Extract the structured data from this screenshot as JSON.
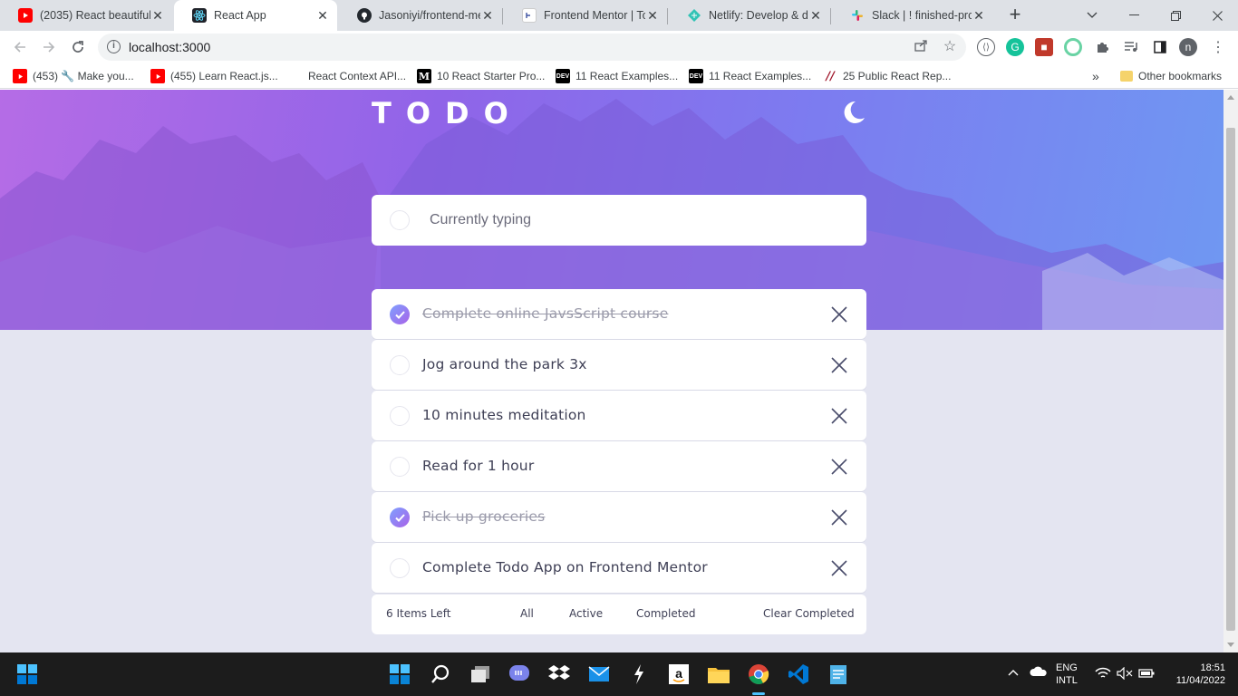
{
  "browser": {
    "tabs": [
      {
        "title": "(2035) React beautiful",
        "icon": "youtube-icon"
      },
      {
        "title": "React App",
        "icon": "react-icon",
        "active": true
      },
      {
        "title": "Jasoniyi/frontend-mer",
        "icon": "github-icon"
      },
      {
        "title": "Frontend Mentor | Too",
        "icon": "frontend-mentor-icon"
      },
      {
        "title": "Netlify: Develop & dep",
        "icon": "netlify-icon"
      },
      {
        "title": "Slack | ! finished-proje",
        "icon": "slack-icon"
      }
    ],
    "url": "localhost:3000",
    "profile_initial": "n",
    "bookmarks": [
      {
        "label": "(453) 🔧 Make you...",
        "icon": "youtube-icon"
      },
      {
        "label": "(455) Learn React.js...",
        "icon": "youtube-icon"
      },
      {
        "label": "React Context API...",
        "icon": "blank-icon"
      },
      {
        "label": "10 React Starter Pro...",
        "icon": "medium-icon"
      },
      {
        "label": "11 React Examples...",
        "icon": "dev-icon"
      },
      {
        "label": "11 React Examples...",
        "icon": "dev-icon"
      },
      {
        "label": "25 Public React Rep...",
        "icon": "slash-icon"
      }
    ],
    "bookmarks_overflow": "»",
    "other_bookmarks": "Other bookmarks"
  },
  "app": {
    "title": "TODO",
    "new_todo_value": "",
    "new_todo_placeholder": "Currently typing",
    "todos": [
      {
        "text": "Complete online JavsScript course",
        "completed": true
      },
      {
        "text": "Jog around the park 3x",
        "completed": false
      },
      {
        "text": "10 minutes meditation",
        "completed": false
      },
      {
        "text": "Read for 1 hour",
        "completed": false
      },
      {
        "text": "Pick up groceries",
        "completed": true
      },
      {
        "text": "Complete Todo App on Frontend Mentor",
        "completed": false
      }
    ],
    "footer": {
      "items_left": "6 Items Left",
      "filters": [
        "All",
        "Active",
        "Completed"
      ],
      "clear": "Clear Completed"
    },
    "colors": {
      "check_gradient_start": "#7ea0ff",
      "check_gradient_end": "#a862e8",
      "page_bg": "#e4e5f1"
    }
  },
  "taskbar": {
    "lang_top": "ENG",
    "lang_bottom": "INTL",
    "time": "18:51",
    "date": "11/04/2022"
  }
}
